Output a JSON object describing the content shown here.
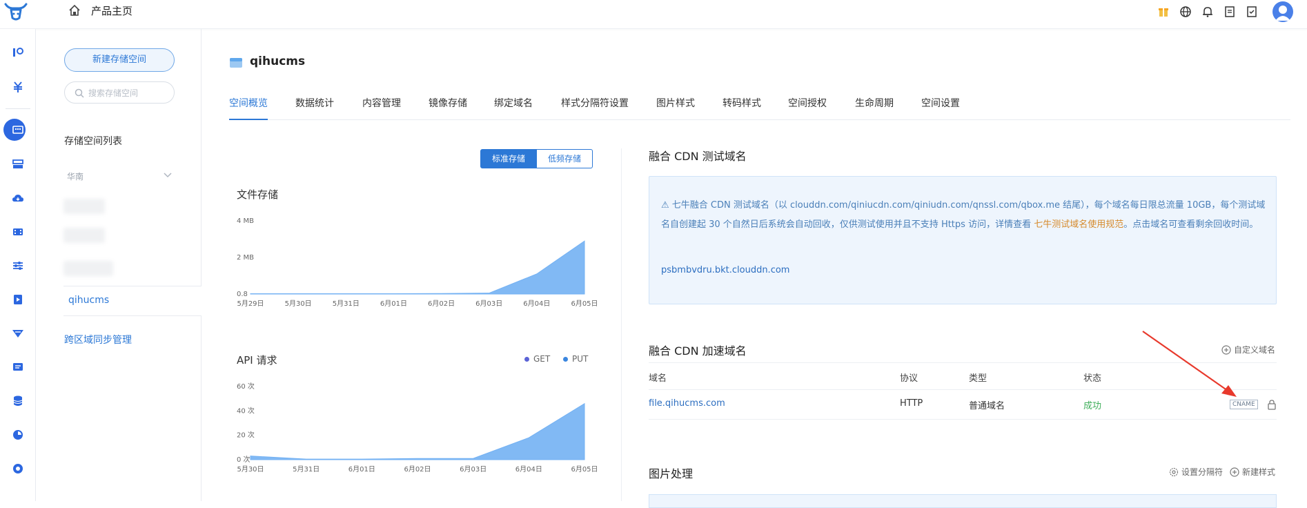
{
  "topbar": {
    "home_label": "产品主页",
    "icons": [
      "gift-icon",
      "globe-icon",
      "bell-icon",
      "document-icon",
      "checklist-icon",
      "user-avatar"
    ]
  },
  "rail": {
    "icons": [
      "rail-analytics-icon",
      "rail-yuan-icon",
      "rail-storage-icon",
      "rail-server-icon",
      "rail-cloud-icon",
      "rail-video-icon",
      "rail-sliders-icon",
      "rail-media-icon",
      "rail-cdn-icon",
      "rail-message-icon",
      "rail-database-icon",
      "rail-pie-icon",
      "rail-coin-icon"
    ],
    "active_index": 2
  },
  "bucketbar": {
    "new_button": "新建存储空间",
    "search_placeholder": "搜索存储空间",
    "list_title": "存储空间列表",
    "region": "华南",
    "selected_bucket": "qihucms",
    "cross_region_link": "跨区域同步管理"
  },
  "main": {
    "bucket_name": "qihucms",
    "tabs": [
      "空间概览",
      "数据统计",
      "内容管理",
      "镜像存储",
      "绑定域名",
      "样式分隔符设置",
      "图片样式",
      "转码样式",
      "空间授权",
      "生命周期",
      "空间设置"
    ],
    "active_tab": 0,
    "storage_toggle": {
      "standard": "标准存储",
      "low_freq": "低频存储",
      "selected": "standard"
    }
  },
  "chart_data": [
    {
      "type": "area",
      "title": "文件存储",
      "x_ticks": [
        "5月29日",
        "5月30日",
        "5月31日",
        "6月01日",
        "6月02日",
        "6月03日",
        "6月04日",
        "6月05日"
      ],
      "y_ticks": [
        "4 MB",
        "2 MB",
        "0.8"
      ],
      "ylim": [
        0,
        4
      ],
      "series": [
        {
          "values": [
            0.02,
            0.02,
            0.02,
            0.02,
            0.03,
            0.05,
            1.1,
            2.9
          ],
          "color": "#73b1f3"
        }
      ]
    },
    {
      "type": "area",
      "title": "API 请求",
      "x_ticks": [
        "5月30日",
        "5月31日",
        "6月01日",
        "6月02日",
        "6月03日",
        "6月04日",
        "6月05日"
      ],
      "y_ticks": [
        "60 次",
        "40 次",
        "20 次",
        "0 次"
      ],
      "ylim": [
        0,
        60
      ],
      "series": [
        {
          "name": "GET",
          "values": [
            0,
            0,
            0,
            0,
            0,
            0,
            0
          ],
          "color": "#5b63d6"
        },
        {
          "name": "PUT",
          "values": [
            3,
            0.5,
            0.5,
            1,
            1,
            18,
            46
          ],
          "color": "#73b1f3"
        }
      ]
    }
  ],
  "cdn_test": {
    "title": "融合 CDN 测试域名",
    "notice_1": "⚠ 七牛融合 CDN 测试域名（以 clouddn.com/qiniucdn.com/qiniudn.com/qnssl.com/qbox.me 结尾），每个域名每日限总流量 10GB，每个测试域名自创建起 30 个自然日后系统会自动回收，仅供测试使用并且不支持 Https 访问，详情查看",
    "notice_link": "七牛测试域名使用规范",
    "notice_2": "。点击域名可查看剩余回收时间。",
    "domain": "psbmbvdru.bkt.clouddn.com"
  },
  "cdn_accel": {
    "title": "融合 CDN 加速域名",
    "custom_domain": "自定义域名",
    "headers": [
      "域名",
      "协议",
      "类型",
      "状态"
    ],
    "rows": [
      {
        "domain": "file.qihucms.com",
        "protocol": "HTTP",
        "type": "普通域名",
        "status": "成功",
        "badge": "CNAME"
      }
    ]
  },
  "image_proc": {
    "title": "图片处理",
    "set_separator": "设置分隔符",
    "new_style": "新建样式"
  },
  "colors": {
    "accent": "#2c78d6",
    "area": "#73b1f3",
    "success": "#3fae5a",
    "arrow": "#e8392c"
  }
}
